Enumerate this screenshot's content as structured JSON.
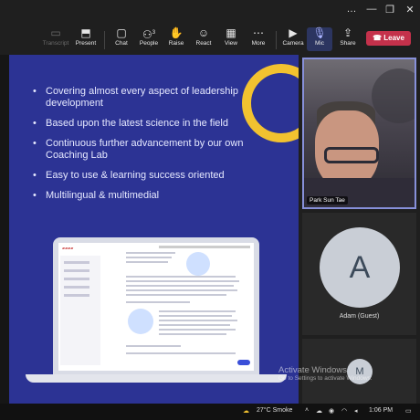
{
  "window_controls": [
    "…",
    "—",
    "❐",
    "✕"
  ],
  "toolbar": {
    "items": [
      {
        "id": "transcript",
        "label": "Transcript",
        "icon": "transcript-icon",
        "glyph": "▭"
      },
      {
        "id": "present",
        "label": "Present",
        "icon": "present-icon",
        "glyph": "⬒"
      },
      {
        "id": "chat",
        "label": "Chat",
        "icon": "chat-icon",
        "glyph": "▢"
      },
      {
        "id": "people",
        "label": "People",
        "icon": "people-icon",
        "glyph": "⚇",
        "badge": "3"
      },
      {
        "id": "raise",
        "label": "Raise",
        "icon": "raise-hand-icon",
        "glyph": "✋"
      },
      {
        "id": "react",
        "label": "React",
        "icon": "react-icon",
        "glyph": "☺"
      },
      {
        "id": "view",
        "label": "View",
        "icon": "view-icon",
        "glyph": "▦"
      },
      {
        "id": "more",
        "label": "More",
        "icon": "more-icon",
        "glyph": "⋯"
      },
      {
        "id": "camera",
        "label": "Camera",
        "icon": "camera-icon",
        "glyph": "▶"
      },
      {
        "id": "mic",
        "label": "Mic",
        "icon": "mic-icon",
        "glyph": "🎙"
      },
      {
        "id": "share",
        "label": "Share",
        "icon": "share-icon",
        "glyph": "⇪"
      }
    ],
    "leave_label": "Leave"
  },
  "slide": {
    "bullets": [
      "Covering almost every aspect of leadership development",
      "Based upon the latest science in the field",
      "Continuous further advancement by our own Coaching Lab",
      "Easy to use & learning success oriented",
      "Multilingual & multimedial"
    ],
    "accent_color": "#f2c230",
    "background_color": "#2c3394"
  },
  "participants": [
    {
      "name": "Park Sun Tae",
      "type": "video"
    },
    {
      "name": "Adam (Guest)",
      "initial": "A",
      "type": "avatar"
    },
    {
      "initial": "M",
      "type": "avatar"
    }
  ],
  "watermark": {
    "title": "Activate Windows",
    "subtitle": "Go to Settings to activate Windows."
  },
  "taskbar": {
    "weather": "27°C Smoke",
    "time": "1:06 PM"
  },
  "colors": {
    "leave": "#c4314b",
    "active_border": "#8790d9",
    "mic_active": "#2c3560"
  }
}
